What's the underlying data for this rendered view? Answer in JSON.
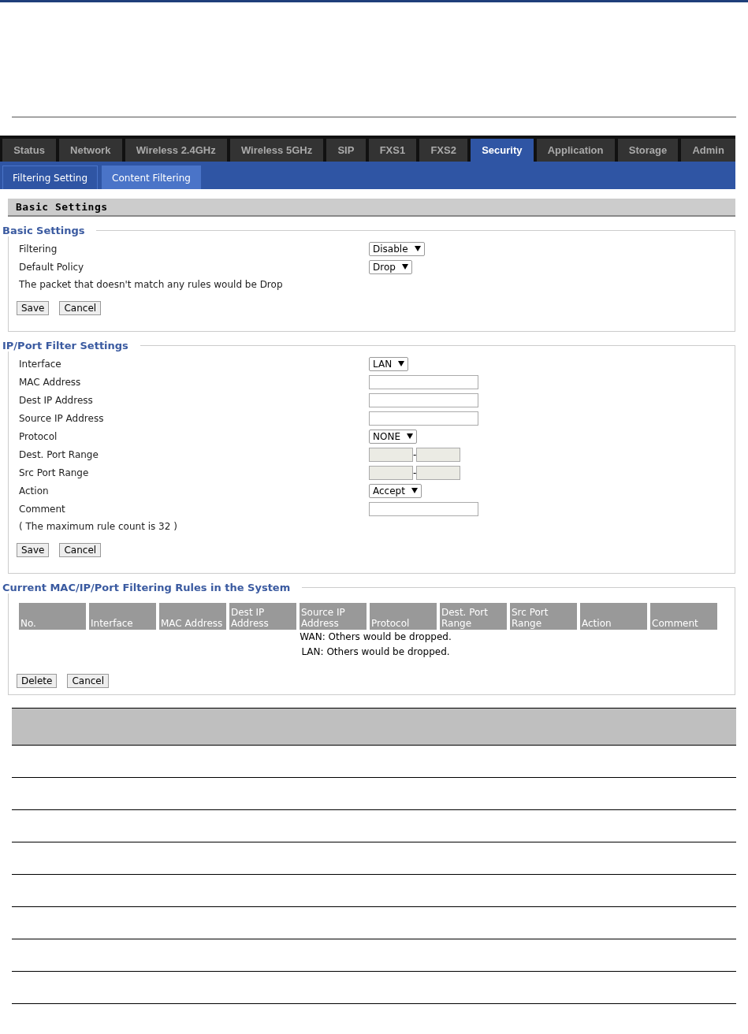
{
  "tabs": [
    {
      "label": "Status",
      "selected": false
    },
    {
      "label": "Network",
      "selected": false
    },
    {
      "label": "Wireless 2.4GHz",
      "selected": false
    },
    {
      "label": "Wireless 5GHz",
      "selected": false
    },
    {
      "label": "SIP",
      "selected": false
    },
    {
      "label": "FXS1",
      "selected": false
    },
    {
      "label": "FXS2",
      "selected": false
    },
    {
      "label": "Security",
      "selected": true
    },
    {
      "label": "Application",
      "selected": false
    },
    {
      "label": "Storage",
      "selected": false
    },
    {
      "label": "Admin",
      "selected": false
    }
  ],
  "subtabs": [
    {
      "label": "Filtering Setting",
      "selected": true
    },
    {
      "label": "Content Filtering",
      "selected": false
    }
  ],
  "page_title": "Basic Settings",
  "basic_settings": {
    "legend": "Basic Settings",
    "fields": [
      {
        "label": "Filtering",
        "kind": "select",
        "value": "Disable"
      },
      {
        "label": "Default Policy",
        "kind": "select",
        "value": "Drop"
      }
    ],
    "note": "The packet that doesn't match any rules would be Drop",
    "buttons": [
      "Save",
      "Cancel"
    ]
  },
  "filter_settings": {
    "legend": "IP/Port Filter Settings",
    "fields": [
      {
        "label": "Interface",
        "kind": "select",
        "value": "LAN"
      },
      {
        "label": "MAC Address",
        "kind": "text"
      },
      {
        "label": "Dest IP Address",
        "kind": "text"
      },
      {
        "label": "Source IP Address",
        "kind": "text"
      },
      {
        "label": "Protocol",
        "kind": "select",
        "value": "NONE"
      },
      {
        "label": "Dest. Port Range",
        "kind": "range",
        "separator": "-",
        "disabled": true
      },
      {
        "label": "Src Port Range",
        "kind": "range",
        "separator": "-",
        "disabled": true
      },
      {
        "label": "Action",
        "kind": "select",
        "value": "Accept"
      },
      {
        "label": "Comment",
        "kind": "text"
      }
    ],
    "note": "( The maximum rule count is 32 )",
    "buttons": [
      "Save",
      "Cancel"
    ]
  },
  "rules": {
    "legend": "Current MAC/IP/Port Filtering Rules in the System",
    "columns": [
      "No.",
      "Interface",
      "MAC Address",
      "Dest IP Address",
      "Source IP Address",
      "Protocol",
      "Dest. Port Range",
      "Src Port Range",
      "Action",
      "Comment"
    ],
    "messages": [
      "WAN: Others would be dropped.",
      "LAN: Others would be dropped."
    ],
    "buttons": [
      "Delete",
      "Cancel"
    ]
  }
}
